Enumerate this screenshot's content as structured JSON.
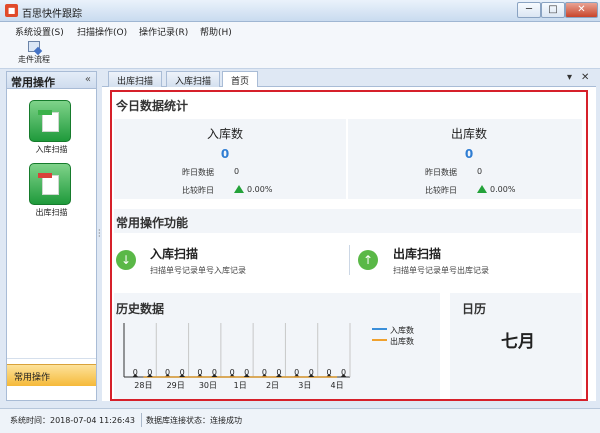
{
  "window": {
    "title": "百思快件跟踪",
    "min": "─",
    "max": "□",
    "close": "✕"
  },
  "menu": [
    "系统设置(S)",
    "扫描操作(O)",
    "操作记录(R)",
    "帮助(H)"
  ],
  "toolbar": {
    "flow_label": "走件流程"
  },
  "left_panel": {
    "title": "常用操作",
    "collapse": "«",
    "items": [
      {
        "label": "入库扫描",
        "icon": "inbound-scan-icon"
      },
      {
        "label": "出库扫描",
        "icon": "outbound-scan-icon"
      }
    ],
    "bottom": "常用操作"
  },
  "tabs": [
    {
      "label": "出库扫描"
    },
    {
      "label": "入库扫描"
    },
    {
      "label": "首页",
      "active": true
    }
  ],
  "tab_controls": {
    "menu": "▾",
    "close": "✕"
  },
  "today": {
    "header": "今日数据统计",
    "inbound": {
      "title": "入库数",
      "value": "0",
      "yesterday_label": "昨日数据",
      "yesterday_value": "0",
      "compare_label": "比较昨日",
      "compare_value": "0.00%"
    },
    "outbound": {
      "title": "出库数",
      "value": "0",
      "yesterday_label": "昨日数据",
      "yesterday_value": "0",
      "compare_label": "比较昨日",
      "compare_value": "0.00%"
    }
  },
  "common_ops": {
    "header": "常用操作功能",
    "items": [
      {
        "title": "入库扫描",
        "desc": "扫描单号记录单号入库记录",
        "icon": "download-arrow-icon"
      },
      {
        "title": "出库扫描",
        "desc": "扫描单号记录单号出库记录",
        "icon": "upload-arrow-icon"
      }
    ]
  },
  "history": {
    "header": "历史数据"
  },
  "calendar": {
    "header": "日历",
    "month": "七月"
  },
  "chart_data": {
    "type": "line",
    "categories": [
      "28日",
      "29日",
      "30日",
      "1日",
      "2日",
      "3日",
      "4日"
    ],
    "series": [
      {
        "name": "入库数",
        "color": "#3b8fd9",
        "values": [
          0,
          0,
          0,
          0,
          0,
          0,
          0
        ]
      },
      {
        "name": "出库数",
        "color": "#f0a12e",
        "values": [
          0,
          0,
          0,
          0,
          0,
          0,
          0
        ]
      }
    ],
    "legend_position": "top-right",
    "grid": true
  },
  "status": {
    "time": "系统时间：2018-07-04 11:26:43",
    "db": "数据库连接状态：连接成功"
  }
}
